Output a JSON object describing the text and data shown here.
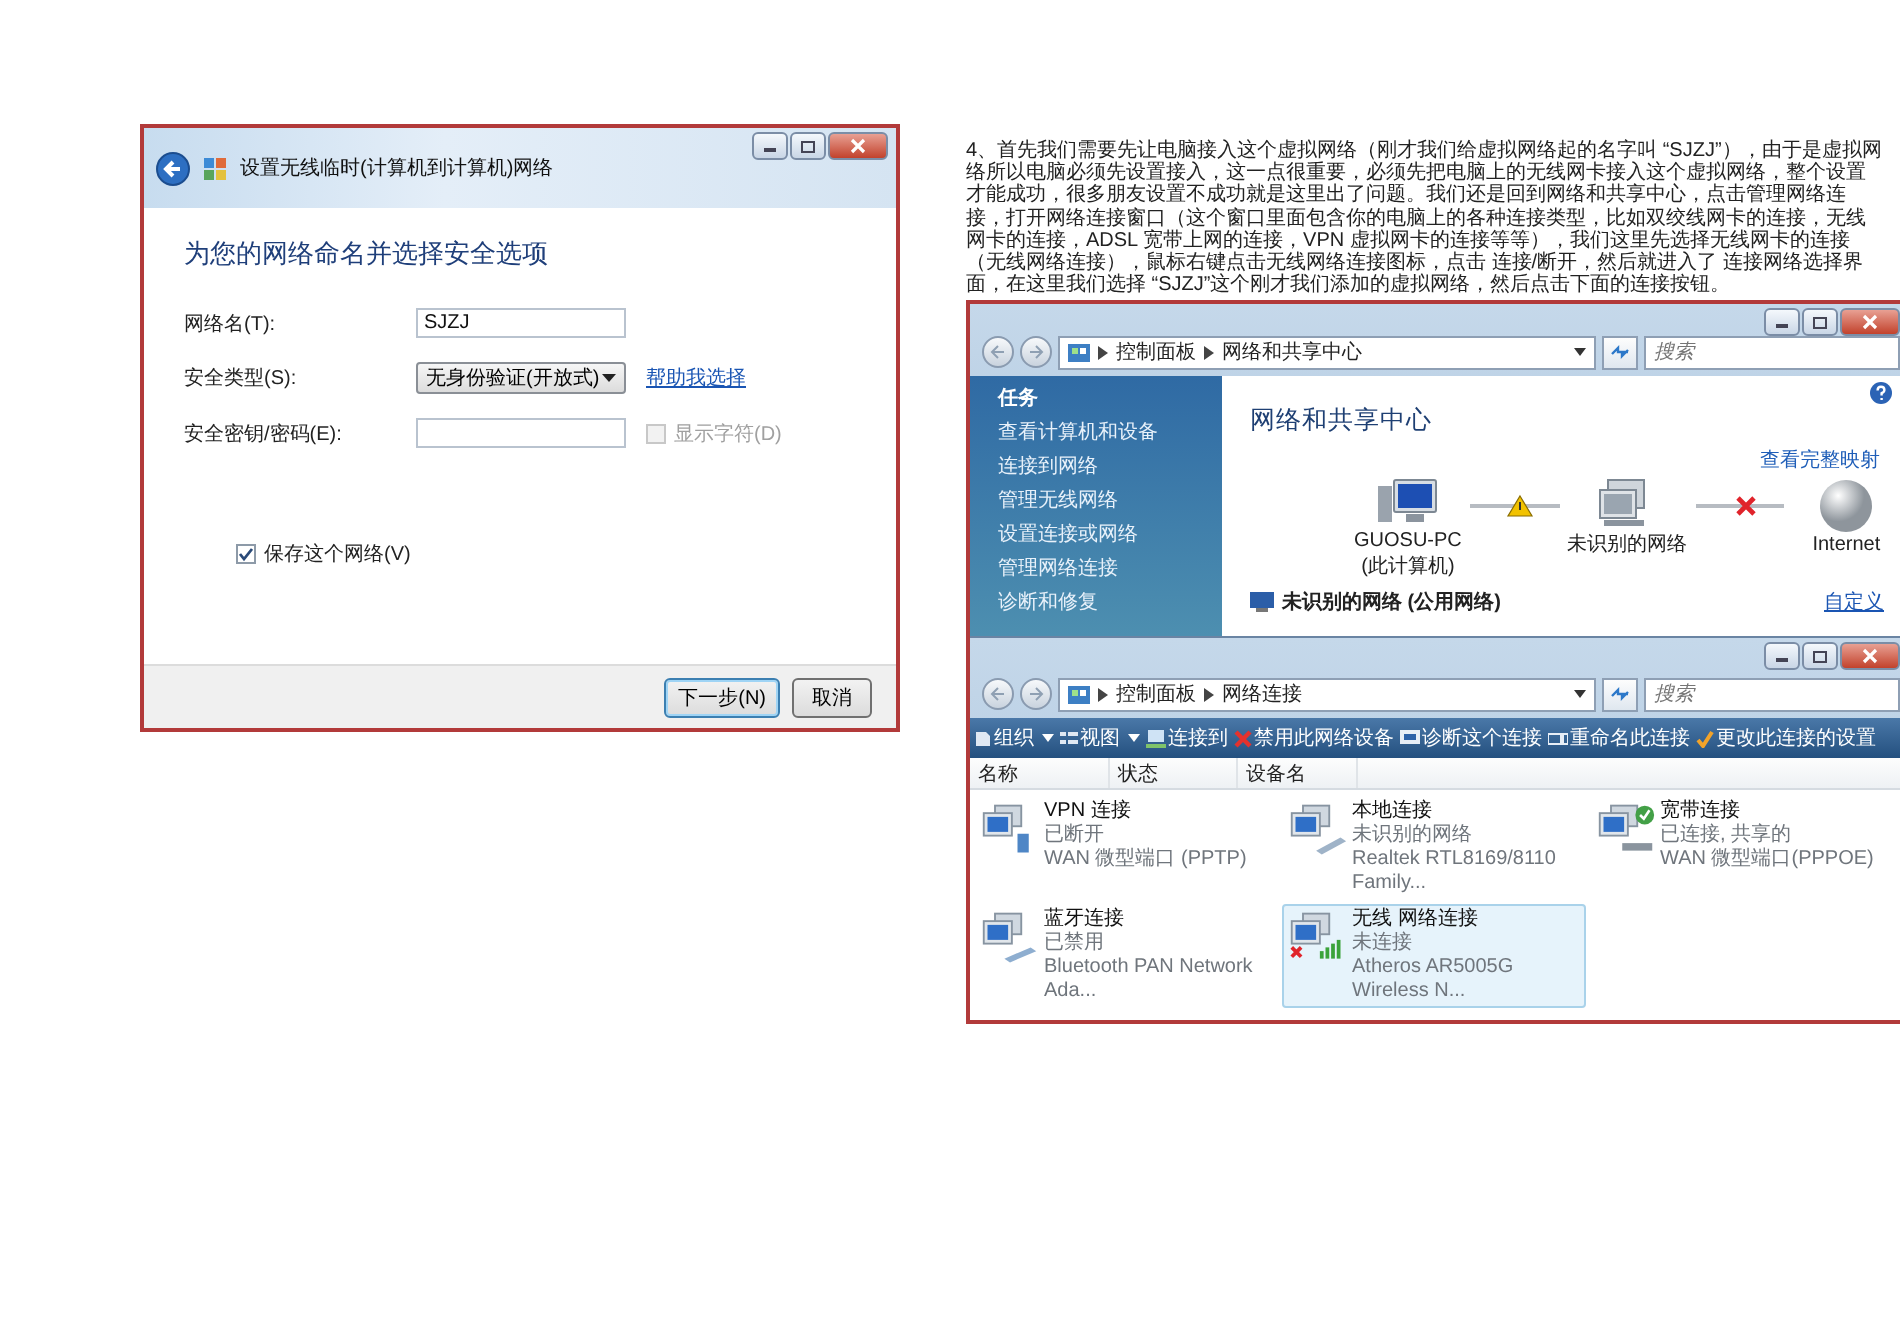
{
  "wizard": {
    "title": "设置无线临时(计算机到计算机)网络",
    "heading": "为您的网络命名并选择安全选项",
    "network_name": {
      "label": "网络名(T):",
      "value": "SJZJ"
    },
    "security_type": {
      "label": "安全类型(S):",
      "value": "无身份验证(开放式)",
      "help_link": "帮助我选择"
    },
    "security_key": {
      "label": "安全密钥/密码(E):",
      "show_characters": {
        "label": "显示字符(D)",
        "checked": false,
        "disabled": true
      }
    },
    "save_network": {
      "label": "保存这个网络(V)",
      "checked": true
    },
    "buttons": [
      {
        "label": "下一步(N)",
        "default": true
      },
      {
        "label": "取消",
        "default": false
      }
    ]
  },
  "article": {
    "paragraph": "4、首先我们需要先让电脑接入这个虚拟网络（刚才我们给虚拟网络起的名字叫 “SJZJ”），由于是虚拟网络所以电脑必须先设置接入，这一点很重要，必须先把电脑上的无线网卡接入这个虚拟网络，整个设置才能成功，很多朋友设置不成功就是这里出了问题。我们还是回到网络和共享中心，点击管理网络连接，打开网络连接窗口（这个窗口里面包含你的电脑上的各种连接类型，比如双绞线网卡的连接，无线网卡的连接，ADSL 宽带上网的连接，VPN 虚拟网卡的连接等等），我们这里先选择无线网卡的连接（无线网络连接），鼠标右键点击无线网络连接图标，点击 连接/断开，然后就进入了 连接网络选择界面，在这里我们选择 “SJZJ”这个刚才我们添加的虚拟网络，然后点击下面的连接按钮。"
  },
  "sharing_center": {
    "breadcrumb": [
      "控制面板",
      "网络和共享中心"
    ],
    "search_placeholder": "搜索",
    "tasks_title": "任务",
    "tasks": [
      "查看计算机和设备",
      "连接到网络",
      "管理无线网络",
      "设置连接或网络",
      "管理网络连接",
      "诊断和修复"
    ],
    "heading": "网络和共享中心",
    "map_link": "查看完整映射",
    "map_nodes": [
      {
        "label": "GUOSU-PC",
        "sublabel": "(此计算机)",
        "kind": "computer"
      },
      {
        "label": "未识别的网络",
        "kind": "network"
      },
      {
        "label": "Internet",
        "kind": "globe"
      }
    ],
    "map_links": [
      {
        "kind": "warning"
      },
      {
        "kind": "broken"
      }
    ],
    "network": {
      "name": "未识别的网络 (公用网络)",
      "action": "自定义"
    }
  },
  "connections_window": {
    "breadcrumb": [
      "控制面板",
      "网络连接"
    ],
    "search_placeholder": "搜索",
    "toolbar": [
      {
        "label": "组织",
        "menu": true
      },
      {
        "label": "视图",
        "menu": true
      },
      {
        "label": "连接到",
        "menu": false
      },
      {
        "label": "禁用此网络设备",
        "menu": false
      },
      {
        "label": "诊断这个连接",
        "menu": false
      },
      {
        "label": "重命名此连接",
        "menu": false
      },
      {
        "label": "更改此连接的设置",
        "menu": false
      }
    ],
    "columns": [
      "名称",
      "状态",
      "设备名"
    ],
    "connections": [
      {
        "name": "VPN 连接",
        "status": "已断开",
        "device": "WAN 微型端口 (PPTP)",
        "kind": "vpn",
        "selected": false
      },
      {
        "name": "本地连接",
        "status": "未识别的网络",
        "device": "Realtek RTL8169/8110 Family...",
        "kind": "lan",
        "selected": false
      },
      {
        "name": "宽带连接",
        "status": "已连接, 共享的",
        "device": "WAN 微型端口(PPPOE)",
        "kind": "broadband",
        "selected": false
      },
      {
        "name": "蓝牙连接",
        "status": "已禁用",
        "device": "Bluetooth PAN Network Ada...",
        "kind": "bluetooth",
        "selected": false
      },
      {
        "name": "无线 网络连接",
        "status": "未连接",
        "device": "Atheros AR5005G Wireless N...",
        "kind": "wireless",
        "selected": true
      }
    ]
  }
}
